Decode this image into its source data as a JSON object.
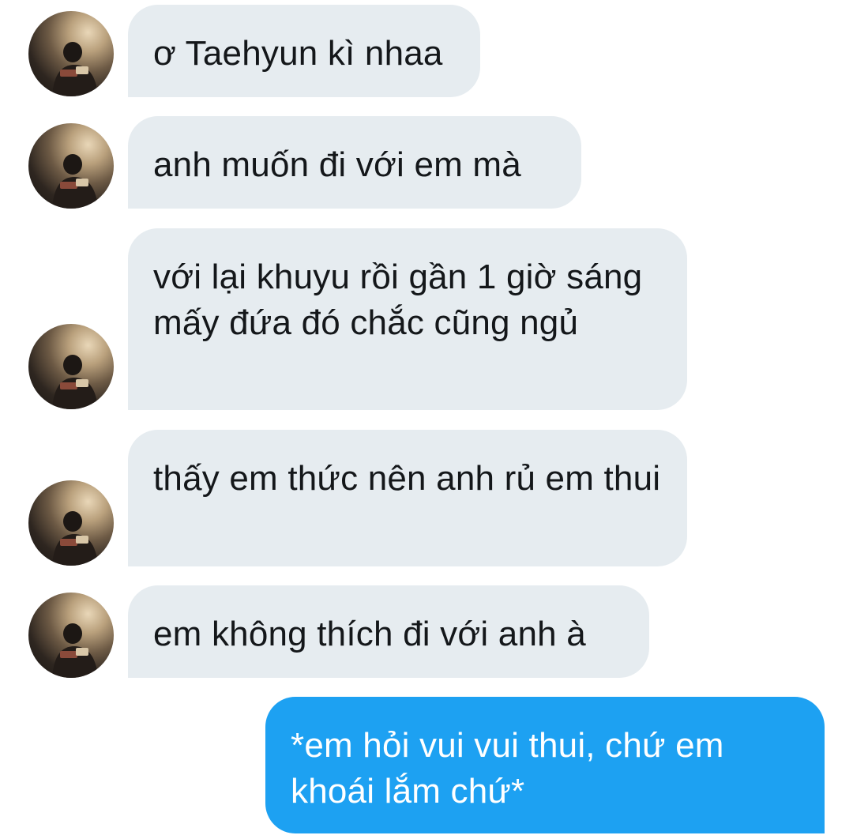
{
  "conversation": {
    "messages": [
      {
        "direction": "incoming",
        "text": "ơ Taehyun kì nhaa"
      },
      {
        "direction": "incoming",
        "text": "anh muốn đi với em mà"
      },
      {
        "direction": "incoming",
        "text": "với lại khuyu rồi gần 1 giờ sáng mấy đứa đó chắc cũng ngủ"
      },
      {
        "direction": "incoming",
        "text": "thấy em thức nên anh rủ em thui"
      },
      {
        "direction": "incoming",
        "text": "em không thích đi với anh à"
      },
      {
        "direction": "outgoing",
        "text": "*em hỏi vui vui thui, chứ em khoái lắm chứ*"
      }
    ]
  },
  "colors": {
    "incoming_bubble": "#e6ecf0",
    "incoming_text": "#14171a",
    "outgoing_bubble": "#1da1f2",
    "outgoing_text": "#ffffff"
  },
  "icons": {
    "avatar": "avatar-photo-icon"
  }
}
